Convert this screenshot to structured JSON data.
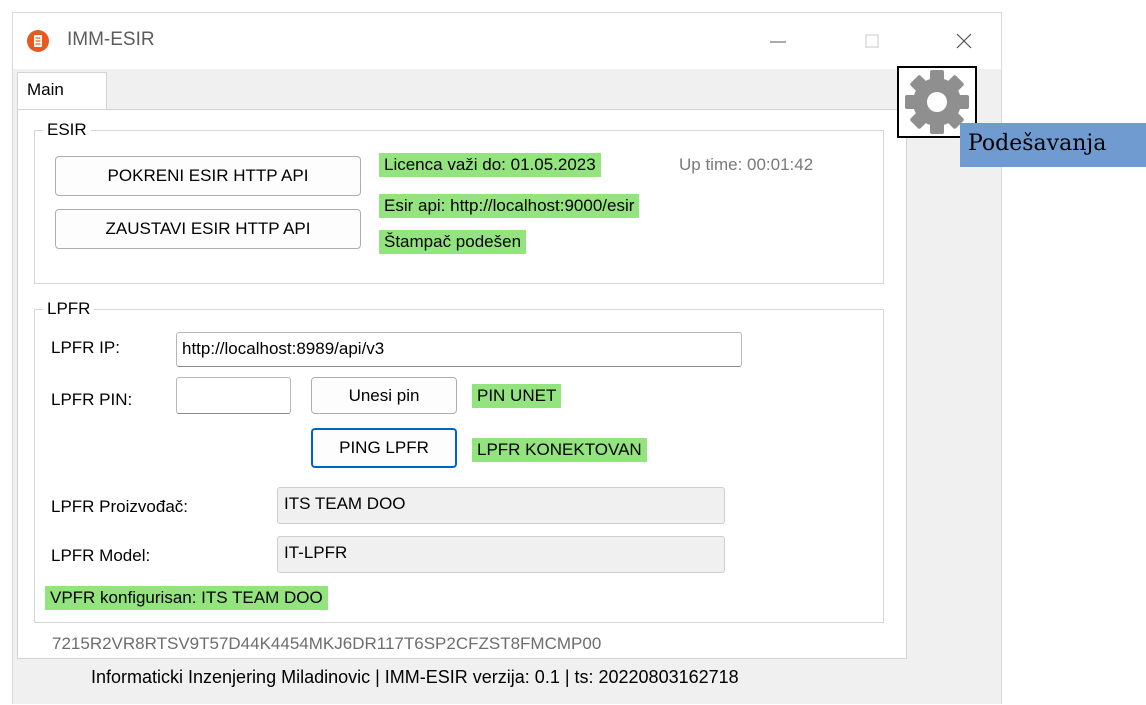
{
  "window": {
    "title": "IMM-ESIR",
    "accent": "#e65a1e"
  },
  "tabs": [
    {
      "label": "Main",
      "selected": true
    }
  ],
  "settings": {
    "label": "Podešavanja",
    "icon": "gear-icon"
  },
  "esir_group": {
    "legend": "ESIR",
    "start_button": "POKRENI ESIR HTTP API",
    "stop_button": "ZAUSTAVI ESIR HTTP API",
    "license": "Licenca važi do: 01.05.2023",
    "uptime": "Up time: 00:01:42",
    "api_url": "Esir api: http://localhost:9000/esir",
    "printer_status": "Štampač podešen"
  },
  "lpfr_group": {
    "legend": "LPFR",
    "ip_label": "LPFR IP:",
    "ip_value": "http://localhost:8989/api/v3",
    "pin_label": "LPFR PIN:",
    "pin_value": "",
    "pin_button": "Unesi pin",
    "pin_status": "PIN UNET",
    "ping_button": "PING LPFR",
    "ping_status": "LPFR KONEKTOVAN",
    "manufacturer_label": "LPFR Proizvođač:",
    "manufacturer_value": "ITS TEAM DOO",
    "model_label": "LPFR Model:",
    "model_value": "IT-LPFR",
    "vpfr_status": "VPFR konfigurisan: ITS TEAM DOO"
  },
  "serial": "7215R2VR8RTSV9T57D44K4454MKJ6DR117T6SP2CFZST8FMCMP00",
  "footer": "Informaticki Inzenjering Miladinovic | IMM-ESIR verzija: 0.1 | ts: 20220803162718",
  "colors": {
    "status_green": "#93e47e",
    "settings_label_bg": "#6f9bd1",
    "focus_blue": "#0067c0"
  }
}
